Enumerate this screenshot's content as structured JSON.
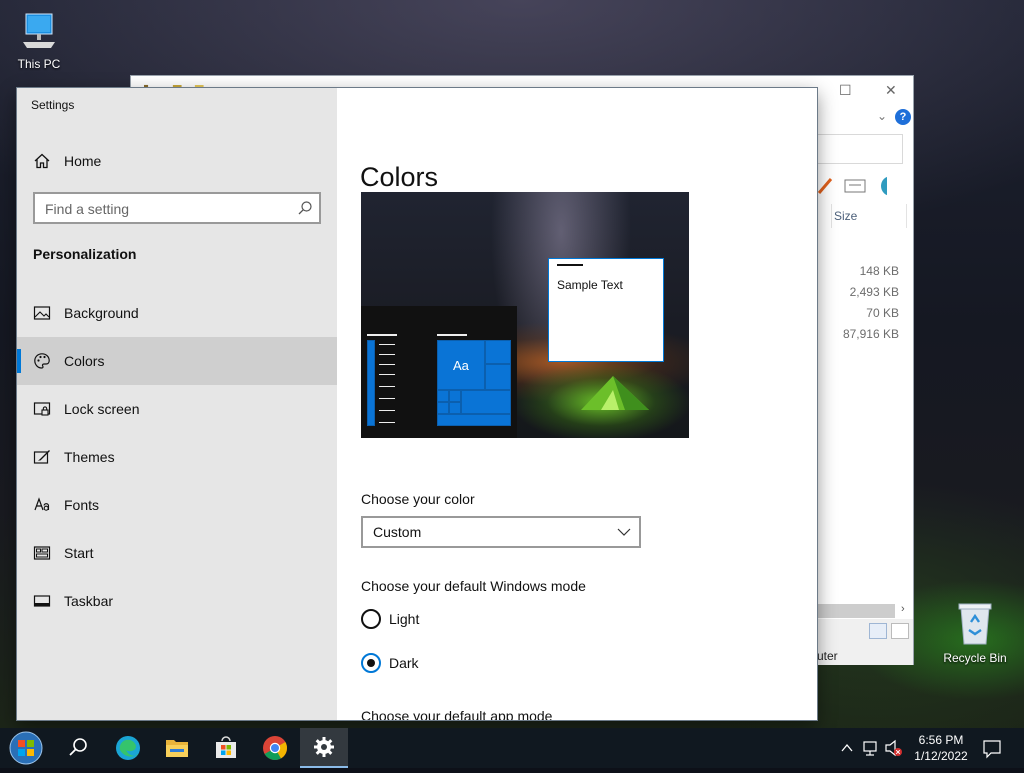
{
  "desktop": {
    "icons": [
      {
        "name": "this-pc",
        "label": "This PC"
      },
      {
        "name": "recycle-bin",
        "label": "Recycle Bin"
      }
    ]
  },
  "explorer": {
    "column_size": "Size",
    "sizes": [
      "148 KB",
      "2,493 KB",
      "70 KB",
      "87,916 KB"
    ],
    "status_text": "uter",
    "help_label": "?"
  },
  "settings": {
    "app_title": "Settings",
    "home_label": "Home",
    "search_placeholder": "Find a setting",
    "section_title": "Personalization",
    "nav": [
      {
        "label": "Background",
        "icon": "picture-icon"
      },
      {
        "label": "Colors",
        "icon": "palette-icon",
        "selected": true
      },
      {
        "label": "Lock screen",
        "icon": "lock-screen-icon"
      },
      {
        "label": "Themes",
        "icon": "themes-icon"
      },
      {
        "label": "Fonts",
        "icon": "fonts-icon"
      },
      {
        "label": "Start",
        "icon": "start-icon"
      },
      {
        "label": "Taskbar",
        "icon": "taskbar-icon"
      }
    ],
    "page_title": "Colors",
    "preview": {
      "sample_text": "Sample Text",
      "tile_text": "Aa"
    },
    "choose_color_label": "Choose your color",
    "color_value": "Custom",
    "windows_mode_label": "Choose your default Windows mode",
    "windows_mode_options": [
      {
        "label": "Light",
        "selected": false
      },
      {
        "label": "Dark",
        "selected": true
      }
    ],
    "app_mode_label": "Choose your default app mode",
    "accent_color": "#0078d7"
  },
  "taskbar": {
    "time": "6:56 PM",
    "date": "1/12/2022",
    "apps": [
      "start-orb",
      "search",
      "edge",
      "file-explorer",
      "store",
      "chrome",
      "settings"
    ]
  }
}
